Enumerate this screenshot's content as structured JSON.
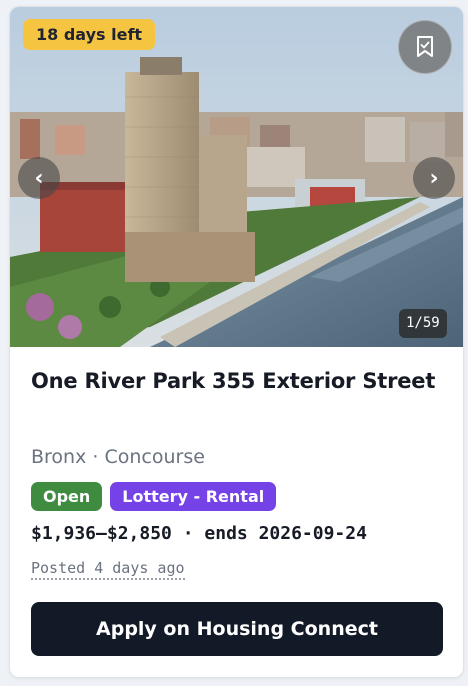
{
  "listing": {
    "days_left": "18 days left",
    "photo_counter": "1/59",
    "title": "One River Park 355 Exterior Street",
    "location": "Bronx · Concourse",
    "tags": [
      "Open",
      "Lottery - Rental"
    ],
    "price_line": "$1,936–$2,850 · ends 2026-09-24",
    "posted": "Posted 4 days ago",
    "apply_label": "Apply on Housing Connect"
  },
  "icons": {
    "save": "bookmark-icon",
    "prev": "chevron-left-icon",
    "next": "chevron-right-icon"
  },
  "colors": {
    "days_badge": "#f5c542",
    "tag_open": "#3f8c41",
    "tag_type": "#7442e6",
    "apply_button": "#121a28"
  }
}
